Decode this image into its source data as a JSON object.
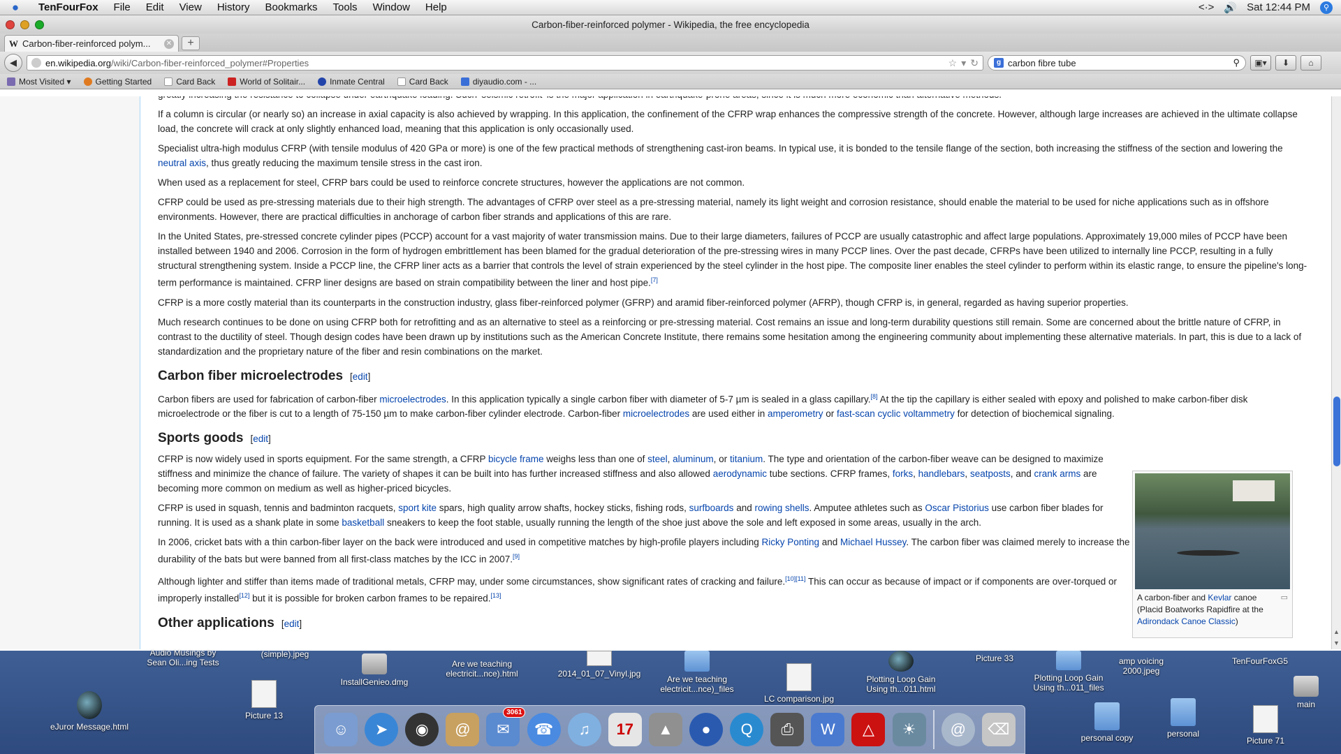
{
  "menubar": {
    "app_name": "TenFourFox",
    "menus": [
      "File",
      "Edit",
      "View",
      "History",
      "Bookmarks",
      "Tools",
      "Window",
      "Help"
    ],
    "clock": "Sat 12:44 PM",
    "extras": "<·>"
  },
  "window": {
    "title": "Carbon-fiber-reinforced polymer - Wikipedia, the free encyclopedia"
  },
  "tab": {
    "label": "Carbon-fiber-reinforced polym...",
    "favicon": "W"
  },
  "navbar": {
    "url_domain": "en.wikipedia.org",
    "url_path": "/wiki/Carbon-fiber-reinforced_polymer#Properties",
    "search_value": "carbon fibre tube"
  },
  "bookmarks": [
    {
      "label": "Most Visited ▾",
      "icon": "folder-icon",
      "color": "#7a6ab0"
    },
    {
      "label": "Getting Started",
      "icon": "firefox-icon",
      "color": "#e07a20"
    },
    {
      "label": "Card Back",
      "icon": "page-icon",
      "color": "#ffffff"
    },
    {
      "label": "World of Solitair...",
      "icon": "cards-icon",
      "color": "#c22"
    },
    {
      "label": "Inmate Central",
      "icon": "c-icon",
      "color": "#2244aa"
    },
    {
      "label": "Card Back",
      "icon": "page-icon",
      "color": "#ffffff"
    },
    {
      "label": "diyaudio.com - ...",
      "icon": "g-icon",
      "color": "#3b6fd8"
    }
  ],
  "article": {
    "cutoff_line": "greatly increasing the resistance to collapse under earthquake loading. Such 'seismic retrofit' is the major application in earthquake-prone areas, since it is much more economic than alternative methods.",
    "p1": "If a column is circular (or nearly so) an increase in axial capacity is also achieved by wrapping. In this application, the confinement of the CFRP wrap enhances the compressive strength of the concrete. However, although large increases are achieved in the ultimate collapse load, the concrete will crack at only slightly enhanced load, meaning that this application is only occasionally used.",
    "p2a": "Specialist ultra-high modulus CFRP (with tensile modulus of 420 GPa or more) is one of the few practical methods of strengthening cast-iron beams. In typical use, it is bonded to the tensile flange of the section, both increasing the stiffness of the section and lowering the ",
    "p2_link": "neutral axis",
    "p2b": ", thus greatly reducing the maximum tensile stress in the cast iron.",
    "p3": "When used as a replacement for steel, CFRP bars could be used to reinforce concrete structures, however the applications are not common.",
    "p4": "CFRP could be used as pre-stressing materials due to their high strength. The advantages of CFRP over steel as a pre-stressing material, namely its light weight and corrosion resistance, should enable the material to be used for niche applications such as in offshore environments. However, there are practical difficulties in anchorage of carbon fiber strands and applications of this are rare.",
    "p5": "In the United States, pre-stressed concrete cylinder pipes (PCCP) account for a vast majority of water transmission mains. Due to their large diameters, failures of PCCP are usually catastrophic and affect large populations. Approximately 19,000 miles of PCCP have been installed between 1940 and 2006. Corrosion in the form of hydrogen embrittlement has been blamed for the gradual deterioration of the pre-stressing wires in many PCCP lines. Over the past decade, CFRPs have been utilized to internally line PCCP, resulting in a fully structural strengthening system. Inside a PCCP line, the CFRP liner acts as a barrier that controls the level of strain experienced by the steel cylinder in the host pipe. The composite liner enables the steel cylinder to perform within its elastic range, to ensure the pipeline's long-term performance is maintained. CFRP liner designs are based on strain compatibility between the liner and host pipe.",
    "p5_ref": "[7]",
    "p6": "CFRP is a more costly material than its counterparts in the construction industry, glass fiber-reinforced polymer (GFRP) and aramid fiber-reinforced polymer (AFRP), though CFRP is, in general, regarded as having superior properties.",
    "p7": "Much research continues to be done on using CFRP both for retrofitting and as an alternative to steel as a reinforcing or pre-stressing material. Cost remains an issue and long-term durability questions still remain. Some are concerned about the brittle nature of CFRP, in contrast to the ductility of steel. Though design codes have been drawn up by institutions such as the American Concrete Institute, there remains some hesitation among the engineering community about implementing these alternative materials. In part, this is due to a lack of standardization and the proprietary nature of the fiber and resin combinations on the market.",
    "h_micro": "Carbon fiber microelectrodes",
    "edit_label": "edit",
    "m1": "Carbon fibers are used for fabrication of carbon-fiber ",
    "m_link1": "microelectrodes",
    "m2": ". In this application typically a single carbon fiber with diameter of 5-7 µm is sealed in a glass capillary.",
    "m_ref": "[8]",
    "m3": " At the tip the capillary is either sealed with epoxy and polished to make carbon-fiber disk microelectrode or the fiber is cut to a length of 75-150 µm to make carbon-fiber cylinder electrode. Carbon-fiber ",
    "m_link2": "microelectrodes",
    "m4": " are used either in ",
    "m_link3": "amperometry",
    "m5": " or ",
    "m_link4": "fast-scan cyclic voltammetry",
    "m6": " for detection of biochemical signaling.",
    "h_sports": "Sports goods",
    "s1a": "CFRP is now widely used in sports equipment. For the same strength, a CFRP ",
    "s1_l1": "bicycle frame",
    "s1b": " weighs less than one of ",
    "s1_l2": "steel",
    "s1c": ", ",
    "s1_l3": "aluminum",
    "s1d": ", or ",
    "s1_l4": "titanium",
    "s1e": ". The type and orientation of the carbon-fiber weave can be designed to maximize stiffness and minimize the chance of failure. The variety of shapes it can be built into has further increased stiffness and also allowed ",
    "s1_l5": "aerodynamic",
    "s1f": " tube sections. CFRP frames, ",
    "s1_l6": "forks",
    "s1g": ", ",
    "s1_l7": "handlebars",
    "s1h": ", ",
    "s1_l8": "seatposts",
    "s1i": ", and ",
    "s1_l9": "crank arms",
    "s1j": " are becoming more common on medium as well as higher-priced bicycles.",
    "s2a": "CFRP is used in squash, tennis and badminton racquets, ",
    "s2_l1": "sport kite",
    "s2b": " spars, high quality arrow shafts, hockey sticks, fishing rods, ",
    "s2_l2": "surfboards",
    "s2c": " and ",
    "s2_l3": "rowing shells",
    "s2d": ". Amputee athletes such as ",
    "s2_l4": "Oscar Pistorius",
    "s2e": " use carbon fiber blades for running. It is used as a shank plate in some ",
    "s2_l5": "basketball",
    "s2f": " sneakers to keep the foot stable, usually running the length of the shoe just above the sole and left exposed in some areas, usually in the arch.",
    "s3a": "In 2006, cricket bats with a thin carbon-fiber layer on the back were introduced and used in competitive matches by high-profile players including ",
    "s3_l1": "Ricky Ponting",
    "s3b": " and ",
    "s3_l2": "Michael Hussey",
    "s3c": ". The carbon fiber was claimed merely to increase the durability of the bats but were banned from all first-class matches by the ICC in 2007.",
    "s3_ref": "[9]",
    "s4a": "Although lighter and stiffer than items made of traditional metals, CFRP may, under some circumstances, show significant rates of cracking and failure.",
    "s4_ref1": "[10][11]",
    "s4b": " This can occur as because of impact or if components are over-torqued or improperly installed",
    "s4_ref2": "[12]",
    "s4c": " but it is possible for broken carbon frames to be repaired.",
    "s4_ref3": "[13]",
    "h_other": "Other applications",
    "thumb_caption_a": "A carbon-fiber and ",
    "thumb_caption_link1": "Kevlar",
    "thumb_caption_b": " canoe (Placid Boatworks Rapidfire at the ",
    "thumb_caption_link2": "Adirondack Canoe Classic",
    "thumb_caption_c": ")"
  },
  "desktop_icons": [
    {
      "label": "eJuror Message.html",
      "kind": "orb"
    },
    {
      "label": "Audio Musings by\nSean Oli...ing Tests",
      "kind": "doc"
    },
    {
      "label": "Picture 13",
      "kind": "doc"
    },
    {
      "label": "(simple).jpeg",
      "kind": "doc"
    },
    {
      "label": "InstallGenieo.dmg",
      "kind": "disk"
    },
    {
      "label": "Are we teaching\nelectricit...nce).html",
      "kind": "doc"
    },
    {
      "label": "2014_01_07_Vinyl.jpg",
      "kind": "doc"
    },
    {
      "label": "Are we teaching\nelectricit...nce)_files",
      "kind": "folder"
    },
    {
      "label": "LC comparison.jpg",
      "kind": "doc"
    },
    {
      "label": "Plotting Loop Gain\nUsing th...011.html",
      "kind": "orb"
    },
    {
      "label": "Picture 33",
      "kind": "doc"
    },
    {
      "label": "Plotting Loop Gain\nUsing th...011_files",
      "kind": "folder"
    },
    {
      "label": "amp voicing\n2000.jpeg",
      "kind": "doc"
    },
    {
      "label": "TenFourFoxG5",
      "kind": "doc"
    },
    {
      "label": "main",
      "kind": "disk"
    },
    {
      "label": "personal copy",
      "kind": "folder"
    },
    {
      "label": "personal",
      "kind": "folder"
    },
    {
      "label": "Picture 71",
      "kind": "doc"
    }
  ],
  "dock": {
    "mail_badge": "3061",
    "items": [
      "finder-icon",
      "safari-icon",
      "dashboard-icon",
      "address-book-icon",
      "mail-icon",
      "ichat-icon",
      "itunes-icon",
      "ical-icon",
      "preview-icon",
      "tenfourfox-icon",
      "quicktime-icon",
      "printer-icon",
      "word-icon",
      "acrobat-icon",
      "iphoto-icon"
    ],
    "colors": [
      "#7a9cd0",
      "#3a86d6",
      "#333333",
      "#c8a060",
      "#5a8ad0",
      "#4a8ae0",
      "#80b0e0",
      "#e6e6e6",
      "#909090",
      "#2a5ab0",
      "#2a8ad0",
      "#555555",
      "#4a7ad0",
      "#cc1111",
      "#6a8aa0"
    ],
    "right_items": [
      "mail-at-icon",
      "trash-icon"
    ]
  }
}
